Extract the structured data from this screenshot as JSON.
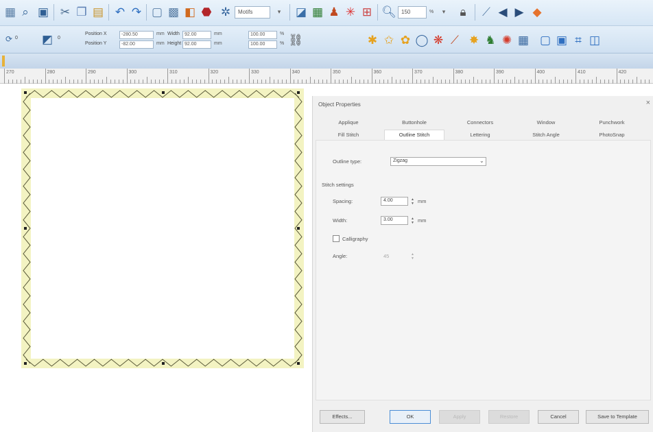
{
  "toolbar1": {
    "icons": [
      "3d-view",
      "zoom-box",
      "save",
      "cut",
      "copy",
      "paste",
      "undo",
      "redo",
      "select-object",
      "select-all",
      "color-palette",
      "stop-sequence",
      "stitch-player",
      "artwork-view",
      "embroidery-view",
      "appliance",
      "recenter",
      "zoom",
      "lock",
      "node-edit",
      "previous",
      "next",
      "color-wheel"
    ],
    "dropdown_motif": "Motifs",
    "zoom_value": "150",
    "zoom_unit": "%"
  },
  "toolbar2": {
    "width_value": "0",
    "width_label": "Position X",
    "posx_value": "-280.50",
    "posy_label": "Position Y",
    "posy_value": "-82.00",
    "unit_mm": "mm",
    "width_size_label": "Width",
    "width_size_value": "92.00",
    "height_size_label": "Height",
    "height_size_value": "92.00",
    "scale_w": "100.00",
    "scale_h": "100.00",
    "percent": "%"
  },
  "ruler": {
    "numbers": [
      "270",
      "280",
      "290",
      "300",
      "310",
      "320",
      "330",
      "340",
      "350",
      "360",
      "370",
      "380",
      "390",
      "400",
      "410",
      "420"
    ]
  },
  "dialog": {
    "title": "Object Properties",
    "close": "×",
    "tabs_row1": [
      "Applique",
      "Buttonhole",
      "Connectors",
      "Window",
      "Punchwork"
    ],
    "tabs_row2": [
      "Fill Stitch",
      "Outline Stitch",
      "Lettering",
      "Stitch Angle",
      "PhotoSnap"
    ],
    "active_tab": "Outline Stitch",
    "outline_type_label": "Outline type:",
    "outline_type_value": "Zigzag",
    "zigzag_settings_label": "Stitch settings",
    "spacing_label": "Spacing:",
    "spacing_value": "4.00",
    "spacing_unit": "mm",
    "width_label": "Width:",
    "width_value": "3.00",
    "width_unit": "mm",
    "calligraphy_label": "Calligraphy",
    "angle_label": "Angle:",
    "angle_value": "45",
    "buttons": {
      "effects": "Effects...",
      "ok": "OK",
      "apply": "Apply",
      "restore": "Restore",
      "cancel": "Cancel",
      "save_template": "Save to Template"
    }
  },
  "colors": {
    "accent": "#4a8dd6",
    "satin_fill": "#f3f3c2",
    "satin_stroke": "#5a5a3a"
  }
}
